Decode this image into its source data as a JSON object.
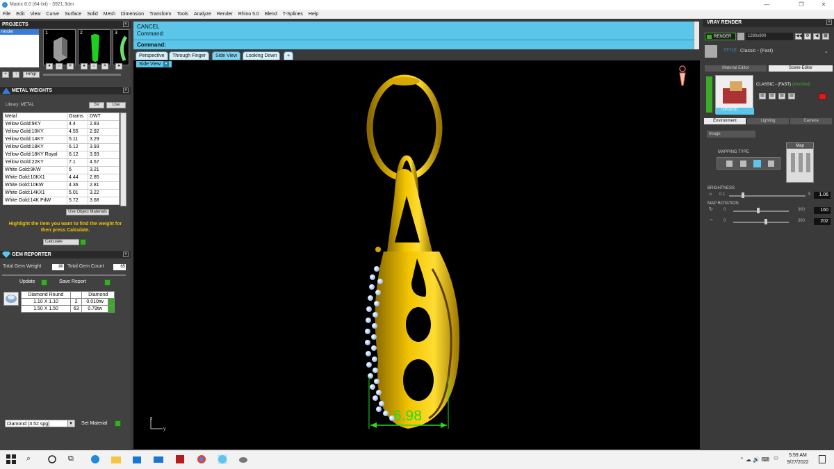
{
  "titlebar": {
    "title": "Matrix 8.0 (64-bit) - 3921.3dm",
    "minimize": "—",
    "restore": "❐",
    "close": "✕"
  },
  "menu": [
    "File",
    "Edit",
    "View",
    "Curve",
    "Surface",
    "Solid",
    "Mesh",
    "Dimension",
    "Transform",
    "Tools",
    "Analyze",
    "Render",
    "Rhino 5.0",
    "Blend",
    "T-Splines",
    "Help"
  ],
  "projects": {
    "title": "PROJECTS",
    "selected": "render",
    "thumbs": [
      {
        "num": "1",
        "color": "#aaaaaa"
      },
      {
        "num": "2",
        "color": "#22cc22"
      },
      {
        "num": "3",
        "color": "#aaccaa"
      }
    ],
    "bottom_buttons": [
      "+",
      "↑",
      "Hmgr"
    ]
  },
  "metal_weights": {
    "title": "METAL WEIGHTS",
    "library_label": "Library: METAL",
    "sv_label": "SV",
    "use_label": "Use",
    "columns": [
      "Metal",
      "Grams",
      "DWT"
    ],
    "rows": [
      [
        "Yellow Gold:9KY",
        "4.4",
        "2.83"
      ],
      [
        "Yellow Gold:10KY",
        "4.55",
        "2.92"
      ],
      [
        "Yellow Gold:14KY",
        "5.11",
        "3.29"
      ],
      [
        "Yellow Gold:18KY",
        "6.12",
        "3.93"
      ],
      [
        "Yellow Gold:18KY Royal",
        "6.12",
        "3.93"
      ],
      [
        "Yellow Gold:22KY",
        "7.1",
        "4.57"
      ],
      [
        "White Gold:9KW",
        "5",
        "3.21"
      ],
      [
        "White Gold:10KX1",
        "4.44",
        "2.85"
      ],
      [
        "White Gold:10KW",
        "4.36",
        "2.81"
      ],
      [
        "White Gold:14KX1",
        "5.01",
        "3.22"
      ],
      [
        "White Gold:14K PdW",
        "5.72",
        "3.68"
      ]
    ],
    "use_object_materials": "Use Object Materials",
    "instruction": "Highlight the item you want to find the weight for then press Calculate.",
    "calculate": "Calculate"
  },
  "gem_reporter": {
    "title": "GEM REPORTER",
    "total_weight_label": "Total Gem Weight",
    "total_weight_value": ".80",
    "total_count_label": "Total Gem Count",
    "total_count_value": "65",
    "update": "Update",
    "save_report": "Save Report",
    "columns": [
      "Diamond Round",
      "",
      "Diamond"
    ],
    "rows": [
      [
        "1.10 X 1.10",
        "2",
        "0.010tw"
      ],
      [
        "1.50 X 1.50",
        "63",
        "0.79tw"
      ]
    ]
  },
  "material_select": {
    "value": "Diamond   (3.52 spg)",
    "set_material": "Set Material"
  },
  "command": {
    "line1": "CANCEL",
    "line2": "Command:",
    "prompt": "Command:"
  },
  "tabs": [
    "Perspective",
    "Through Finger",
    "Side View",
    "Looking Down",
    "+"
  ],
  "active_tab": "Side View",
  "viewport": {
    "label": "Side View",
    "dimension": "6.98",
    "axis_z": "z",
    "axis_y": "y"
  },
  "vray": {
    "title": "VRAY RENDER",
    "render_btn": "RENDER",
    "resolution": "1280x900",
    "style_label": "STYLE",
    "style_value": "Classic - (Fast)",
    "subtabs": [
      "Material Editor",
      "Scene Editor"
    ],
    "preset_name": "CLASSIC - (FAST)",
    "preset_state": "(Modified)",
    "update": "UPDATE",
    "env_tabs": [
      "Environment",
      "Lighting",
      "Camera"
    ],
    "env_source": "Image",
    "mapping_type": "MAPPING TYPE",
    "map_label": "Map",
    "brightness_label": "BRIGHTNESS",
    "brightness_min": "0.1",
    "brightness_max": "5",
    "brightness_value": "1.06",
    "map_rotation_label": "MAP ROTATION",
    "rot1_min": "0",
    "rot1_max": "360",
    "rot1_value": "160",
    "rot2_min": "0",
    "rot2_max": "360",
    "rot2_value": "202"
  },
  "taskbar": {
    "time": "5:59 AM",
    "date": "9/27/2022"
  },
  "colors": {
    "gold": "#e0b000",
    "accent": "#5bc6ea",
    "dimension": "#22dd22"
  }
}
